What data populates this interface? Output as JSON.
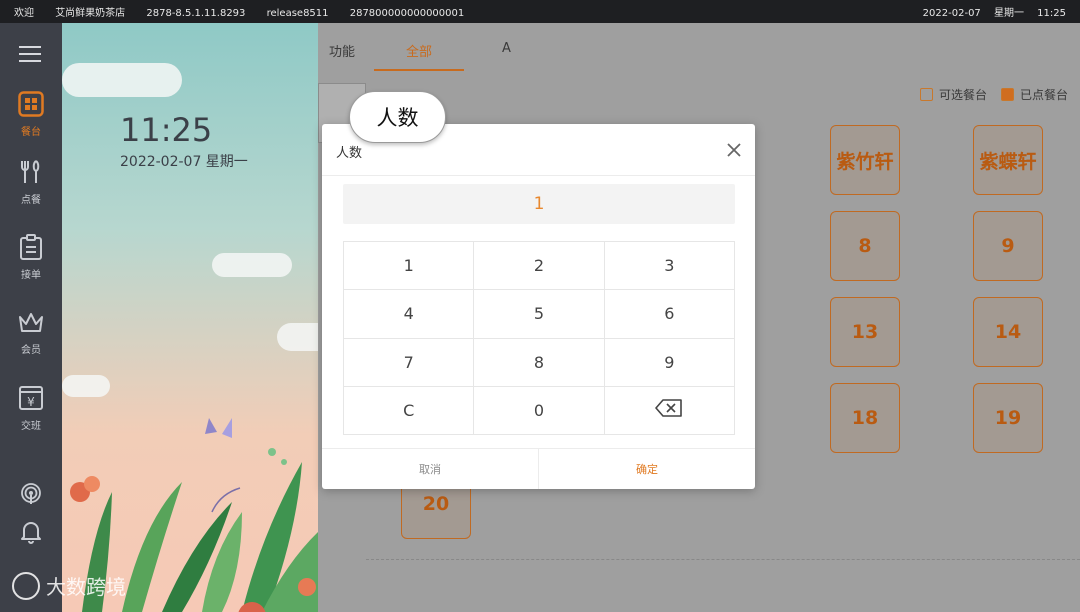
{
  "statusbar": {
    "welcome": "欢迎",
    "shop": "艾尚鲜果奶茶店",
    "version": "2878-8.5.1.11.8293",
    "release": "release8511",
    "device_id": "287800000000000001",
    "date": "2022-02-07",
    "weekday": "星期一",
    "time": "11:25"
  },
  "nav": {
    "items": [
      {
        "label": "餐台",
        "icon": "table-grid-icon"
      },
      {
        "label": "点餐",
        "icon": "fork-knife-icon"
      },
      {
        "label": "接单",
        "icon": "clipboard-icon"
      },
      {
        "label": "会员",
        "icon": "crown-icon"
      },
      {
        "label": "交班",
        "icon": "yen-register-icon"
      }
    ]
  },
  "panel": {
    "clock": "11:25",
    "date": "2022-02-07  星期一"
  },
  "main": {
    "tabs": [
      {
        "label": "功能"
      },
      {
        "label": "全部"
      },
      {
        "label": "A"
      }
    ],
    "legend": {
      "available": "可选餐台",
      "ordered": "已点餐台"
    },
    "tables": [
      "紫竹轩",
      "紫蝶轩",
      "8",
      "9",
      "13",
      "14",
      "18",
      "19",
      "20"
    ]
  },
  "dialog": {
    "title": "人数",
    "value": "1",
    "keys": [
      "1",
      "2",
      "3",
      "4",
      "5",
      "6",
      "7",
      "8",
      "9",
      "C",
      "0",
      "⌫"
    ],
    "cancel": "取消",
    "confirm": "确定"
  },
  "callout": {
    "text": "人数"
  },
  "watermark": {
    "text": "大数跨境"
  },
  "colors": {
    "accent": "#e07a22",
    "nav_bg": "#3d4048",
    "statusbar_bg": "#1e1f22"
  }
}
